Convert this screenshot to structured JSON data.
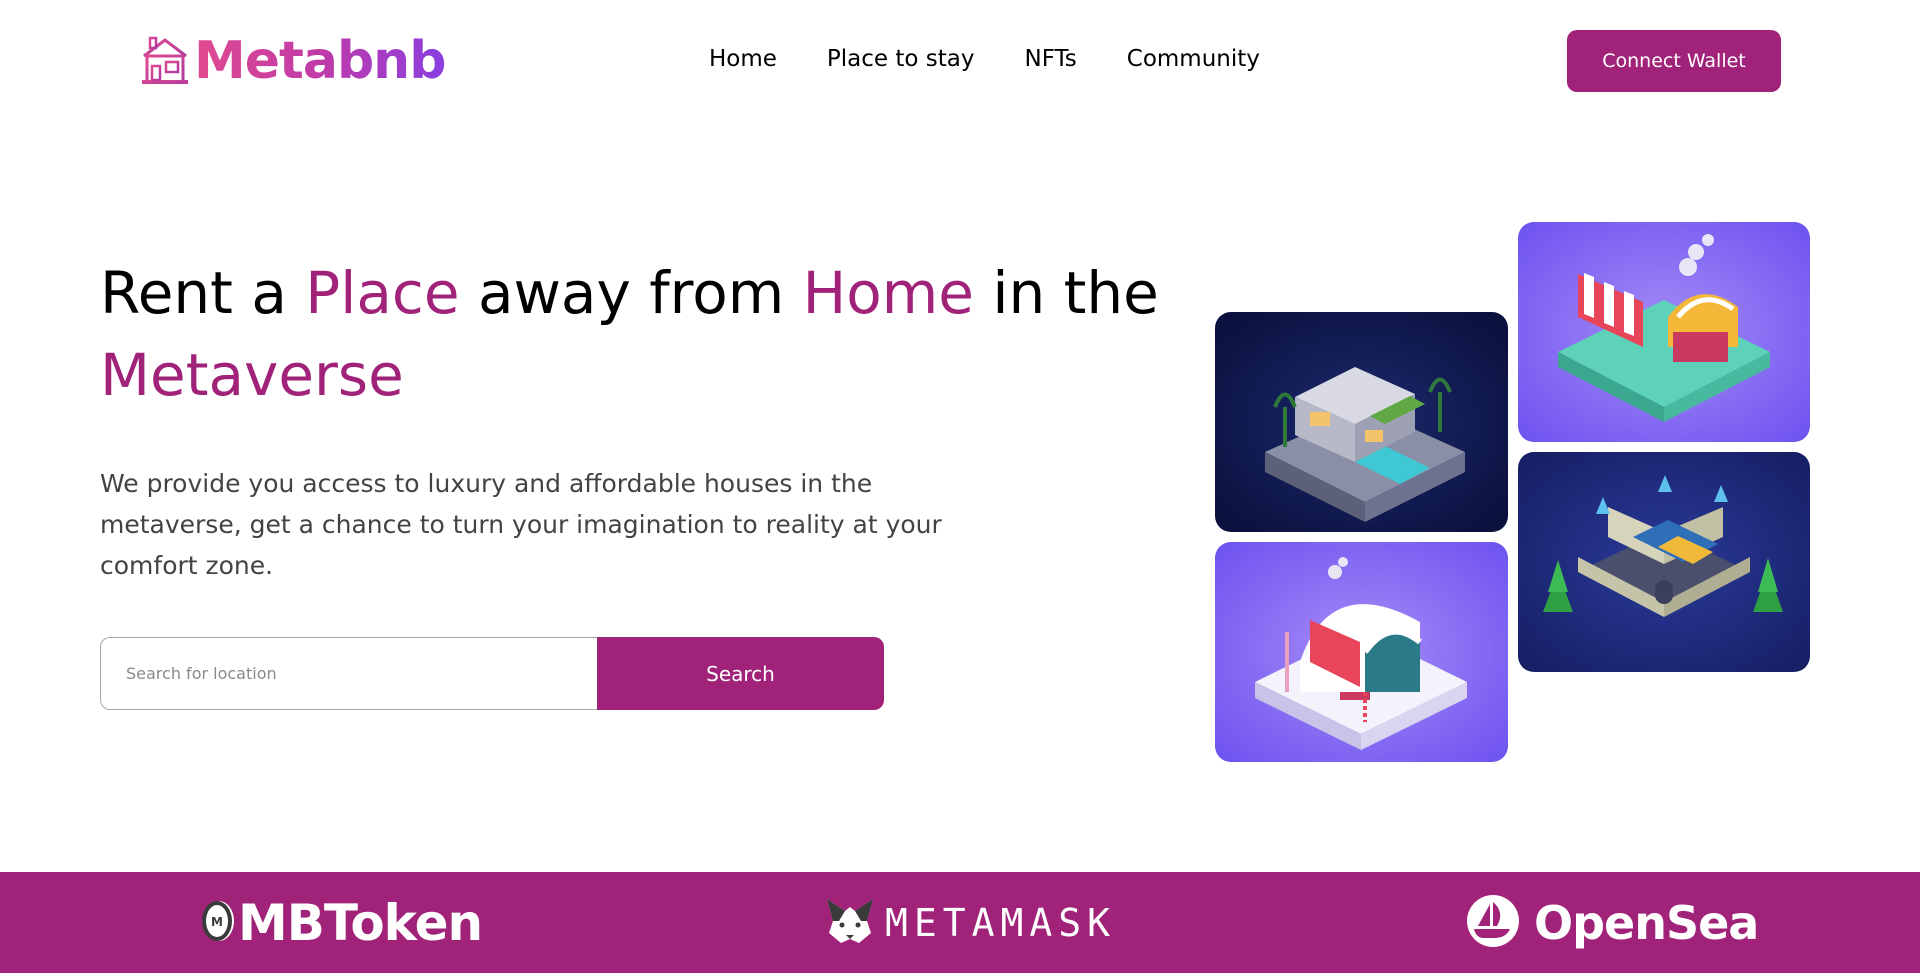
{
  "brand": {
    "name": "Metabnb",
    "icon": "house-icon",
    "gradient": [
      "#e04a8f",
      "#8a3ee0"
    ]
  },
  "nav": {
    "items": [
      {
        "label": "Home"
      },
      {
        "label": "Place to stay"
      },
      {
        "label": "NFTs"
      },
      {
        "label": "Community"
      }
    ]
  },
  "header": {
    "connect_label": "Connect Wallet"
  },
  "hero": {
    "headline": {
      "part1": "Rent a ",
      "accent1": "Place",
      "part2": " away from ",
      "accent2": "Home",
      "part3": " in the ",
      "accent3": "Metaverse"
    },
    "description": "We provide you access to luxury and affordable houses in the metaverse, get a chance to turn your imagination to reality at your comfort zone.",
    "search": {
      "placeholder": "Search for location",
      "value": "",
      "button_label": "Search"
    },
    "images": [
      {
        "name": "isometric-villa-image"
      },
      {
        "name": "isometric-market-image"
      },
      {
        "name": "isometric-snow-cabin-image"
      },
      {
        "name": "isometric-castle-image"
      }
    ]
  },
  "partners": [
    {
      "label": "MBToken",
      "icon": "mbtoken-coin-icon"
    },
    {
      "label": "METAMASK",
      "icon": "metamask-fox-icon"
    },
    {
      "label": "OpenSea",
      "icon": "opensea-boat-icon"
    }
  ],
  "colors": {
    "accent": "#a02279",
    "text": "#000000",
    "muted_text": "#434343"
  }
}
